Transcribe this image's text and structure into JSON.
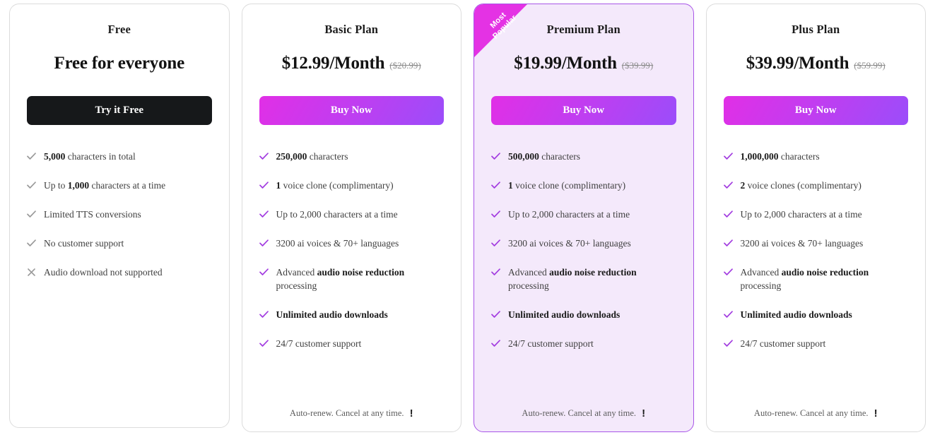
{
  "colors": {
    "accent_magenta": "#e432e4",
    "accent_violet": "#9b4dfa",
    "highlight_bg": "#f4e9fb",
    "highlight_border": "#a855e8",
    "dark_button": "#16181a",
    "check_gray": "#9a9a9a",
    "check_purple": "#a23ce0"
  },
  "ribbon": {
    "line1": "Most",
    "line2": "Popular"
  },
  "footer_note": {
    "text": "Auto-renew. Cancel at any time.",
    "icon": "exclamation-icon",
    "icon_glyph": "!"
  },
  "plans": [
    {
      "id": "free",
      "name": "Free",
      "price": "Free for everyone",
      "old_price": "",
      "cta": "Try it Free",
      "cta_style": "dark",
      "highlight": false,
      "has_footer": false,
      "features": [
        {
          "icon": "check-icon",
          "bold_prefix": "5,000",
          "text": " characters in total",
          "all_bold": false
        },
        {
          "icon": "check-icon",
          "bold_prefix": "",
          "text": "Up to ",
          "bold_mid": "1,000",
          "text2": " characters at a time",
          "all_bold": false
        },
        {
          "icon": "check-icon",
          "bold_prefix": "",
          "text": "Limited TTS conversions",
          "all_bold": false
        },
        {
          "icon": "check-icon",
          "bold_prefix": "",
          "text": "No customer support",
          "all_bold": false
        },
        {
          "icon": "cross-icon",
          "bold_prefix": "",
          "text": "Audio download not supported",
          "all_bold": false
        }
      ]
    },
    {
      "id": "basic",
      "name": "Basic Plan",
      "price": "$12.99/Month",
      "old_price": "($20.99)",
      "cta": "Buy Now",
      "cta_style": "gradient",
      "highlight": false,
      "has_footer": true,
      "features": [
        {
          "icon": "check-icon",
          "bold_prefix": "250,000",
          "text": " characters",
          "all_bold": false
        },
        {
          "icon": "check-icon",
          "bold_prefix": "1",
          "text": " voice clone (complimentary)",
          "all_bold": false
        },
        {
          "icon": "check-icon",
          "bold_prefix": "",
          "text": "Up to 2,000 characters at a time",
          "all_bold": false
        },
        {
          "icon": "check-icon",
          "bold_prefix": "",
          "text": "3200 ai voices & 70+ languages",
          "all_bold": false
        },
        {
          "icon": "check-icon",
          "bold_prefix": "",
          "text": "Advanced ",
          "bold_mid": "audio noise reduction",
          "text2": " processing",
          "all_bold": false
        },
        {
          "icon": "check-icon",
          "bold_prefix": "",
          "text": "Unlimited audio downloads",
          "all_bold": true
        },
        {
          "icon": "check-icon",
          "bold_prefix": "",
          "text": "24/7 customer support",
          "all_bold": false
        }
      ]
    },
    {
      "id": "premium",
      "name": "Premium Plan",
      "price": "$19.99/Month",
      "old_price": "($39.99)",
      "cta": "Buy Now",
      "cta_style": "gradient",
      "highlight": true,
      "has_footer": true,
      "features": [
        {
          "icon": "check-icon",
          "bold_prefix": "500,000",
          "text": " characters",
          "all_bold": false
        },
        {
          "icon": "check-icon",
          "bold_prefix": "1",
          "text": " voice clone (complimentary)",
          "all_bold": false
        },
        {
          "icon": "check-icon",
          "bold_prefix": "",
          "text": "Up to 2,000 characters at a time",
          "all_bold": false
        },
        {
          "icon": "check-icon",
          "bold_prefix": "",
          "text": "3200 ai voices & 70+ languages",
          "all_bold": false
        },
        {
          "icon": "check-icon",
          "bold_prefix": "",
          "text": "Advanced ",
          "bold_mid": "audio noise reduction",
          "text2": " processing",
          "all_bold": false
        },
        {
          "icon": "check-icon",
          "bold_prefix": "",
          "text": "Unlimited audio downloads",
          "all_bold": true
        },
        {
          "icon": "check-icon",
          "bold_prefix": "",
          "text": "24/7 customer support",
          "all_bold": false
        }
      ]
    },
    {
      "id": "plus",
      "name": "Plus Plan",
      "price": "$39.99/Month",
      "old_price": "($59.99)",
      "cta": "Buy Now",
      "cta_style": "gradient",
      "highlight": false,
      "has_footer": true,
      "features": [
        {
          "icon": "check-icon",
          "bold_prefix": "1,000,000",
          "text": " characters",
          "all_bold": false
        },
        {
          "icon": "check-icon",
          "bold_prefix": "2",
          "text": " voice clones (complimentary)",
          "all_bold": false
        },
        {
          "icon": "check-icon",
          "bold_prefix": "",
          "text": "Up to 2,000 characters at a time",
          "all_bold": false
        },
        {
          "icon": "check-icon",
          "bold_prefix": "",
          "text": "3200 ai voices & 70+ languages",
          "all_bold": false
        },
        {
          "icon": "check-icon",
          "bold_prefix": "",
          "text": "Advanced ",
          "bold_mid": "audio noise reduction",
          "text2": " processing",
          "all_bold": false
        },
        {
          "icon": "check-icon",
          "bold_prefix": "",
          "text": "Unlimited audio downloads",
          "all_bold": true
        },
        {
          "icon": "check-icon",
          "bold_prefix": "",
          "text": "24/7 customer support",
          "all_bold": false
        }
      ]
    }
  ]
}
